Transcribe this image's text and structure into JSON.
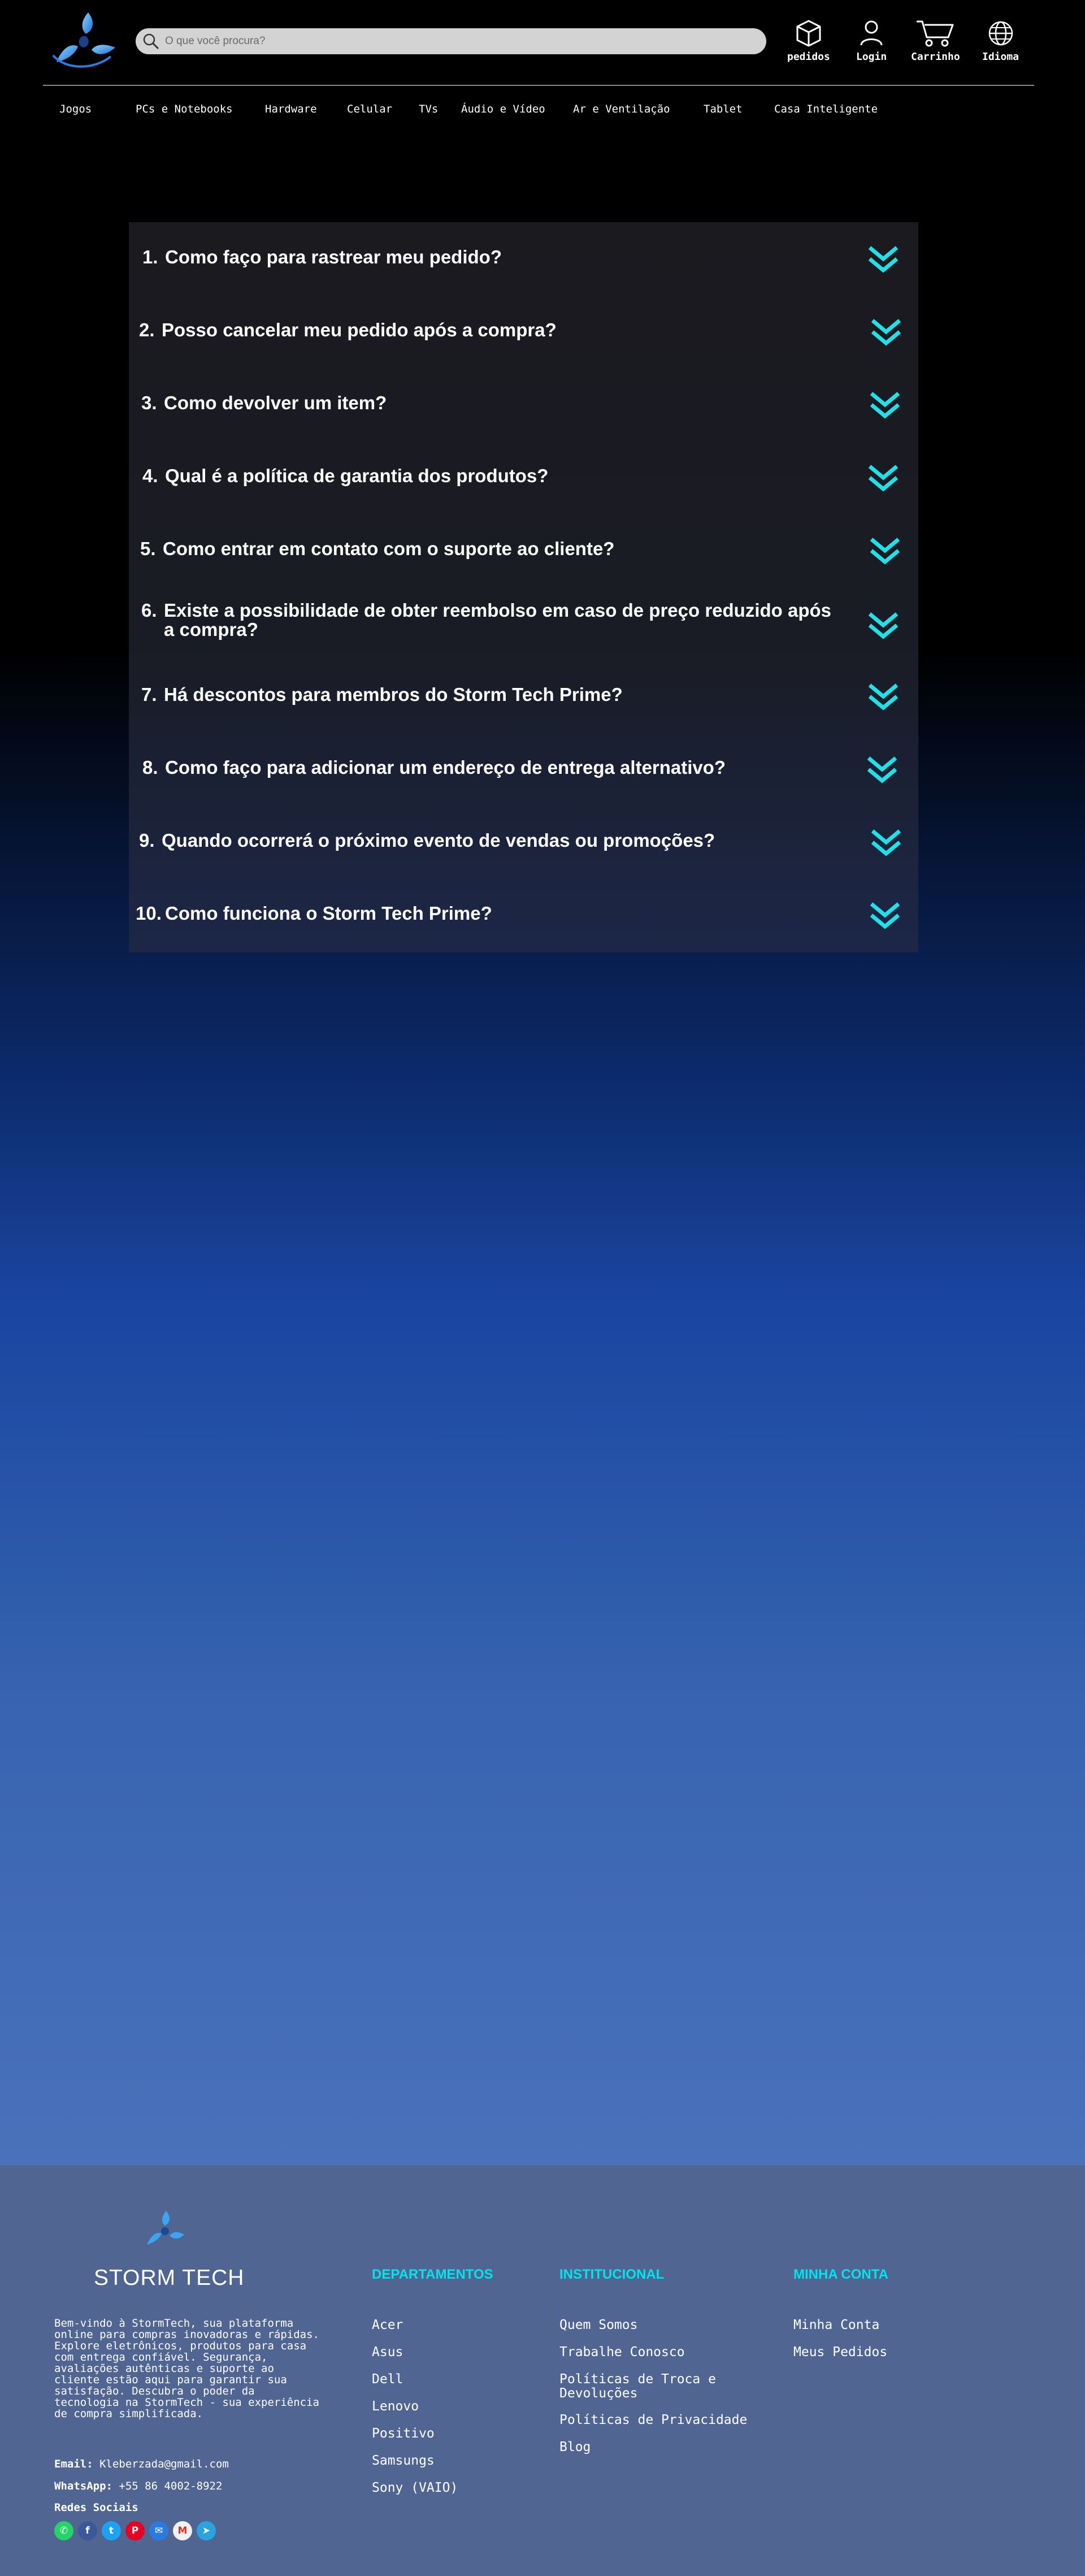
{
  "header": {
    "search_placeholder": "O que você procura?",
    "icons": [
      {
        "name": "box-icon",
        "label": "pedidos"
      },
      {
        "name": "user-icon",
        "label": "Login"
      },
      {
        "name": "cart-icon",
        "label": "Carrinho"
      },
      {
        "name": "globe-icon",
        "label": "Idioma"
      }
    ]
  },
  "nav": [
    "Jogos",
    "PCs e Notebooks",
    "Hardware",
    "Celular",
    "TVs",
    "Áudio e Vídeo",
    "Ar e Ventilação",
    "Tablet",
    "Casa Inteligente"
  ],
  "faq": [
    {
      "num": "1.",
      "text": "Como faço para rastrear meu pedido?"
    },
    {
      "num": "2.",
      "text": "Posso cancelar meu pedido após a compra?"
    },
    {
      "num": "3.",
      "text": "Como devolver um item?"
    },
    {
      "num": "4.",
      "text": "Qual é a política de garantia dos produtos?"
    },
    {
      "num": "5.",
      "text": "Como entrar em contato com o suporte ao cliente?"
    },
    {
      "num": "6.",
      "text": "Existe a possibilidade de obter reembolso em caso de preço reduzido após a compra?"
    },
    {
      "num": "7.",
      "text": "Há descontos para membros do Storm Tech Prime?"
    },
    {
      "num": "8.",
      "text": "Como faço para adicionar um endereço de entrega alternativo?"
    },
    {
      "num": "9.",
      "text": "Quando ocorrerá o próximo evento de vendas ou promoções?"
    },
    {
      "num": "10.",
      "text": "Como funciona o Storm Tech Prime?"
    }
  ],
  "footer": {
    "brand": "STORM TECH",
    "about": "Bem-vindo à StormTech, sua plataforma online para compras inovadoras e rápidas. Explore eletrônicos, produtos para casa com entrega confiável. Segurança, avaliações autênticas e suporte ao cliente estão aqui para garantir sua satisfação. Descubra o poder da tecnologia na StormTech - sua experiência de compra simplificada.",
    "email_label": "Email:",
    "email": "Kleberzada@gmail.com",
    "whatsapp_label": "WhatsApp:",
    "whatsapp": "+55 86 4002-8922",
    "social_label": "Redes Sociais",
    "social": [
      "whatsapp-icon",
      "facebook-icon",
      "twitter-icon",
      "pinterest-icon",
      "email-icon",
      "gmail-icon",
      "telegram-icon"
    ],
    "departamentos": {
      "title": "DEPARTAMENTOS",
      "items": [
        "Acer",
        "Asus",
        "Dell",
        "Lenovo",
        "Positivo",
        "Samsungs",
        "Sony (VAIO)"
      ]
    },
    "institucional": {
      "title": "INSTITUCIONAL",
      "items": [
        "Quem Somos",
        "Trabalhe Conosco",
        "Políticas de Troca e Devoluções",
        "Políticas de Privacidade",
        "Blog"
      ]
    },
    "minha_conta": {
      "title": "MINHA CONTA",
      "items": [
        "Minha Conta",
        "Meus Pedidos"
      ]
    }
  },
  "colors": {
    "accent": "#00e5ef",
    "chevron": "#22e0e8",
    "footer_bg": "#506591"
  }
}
